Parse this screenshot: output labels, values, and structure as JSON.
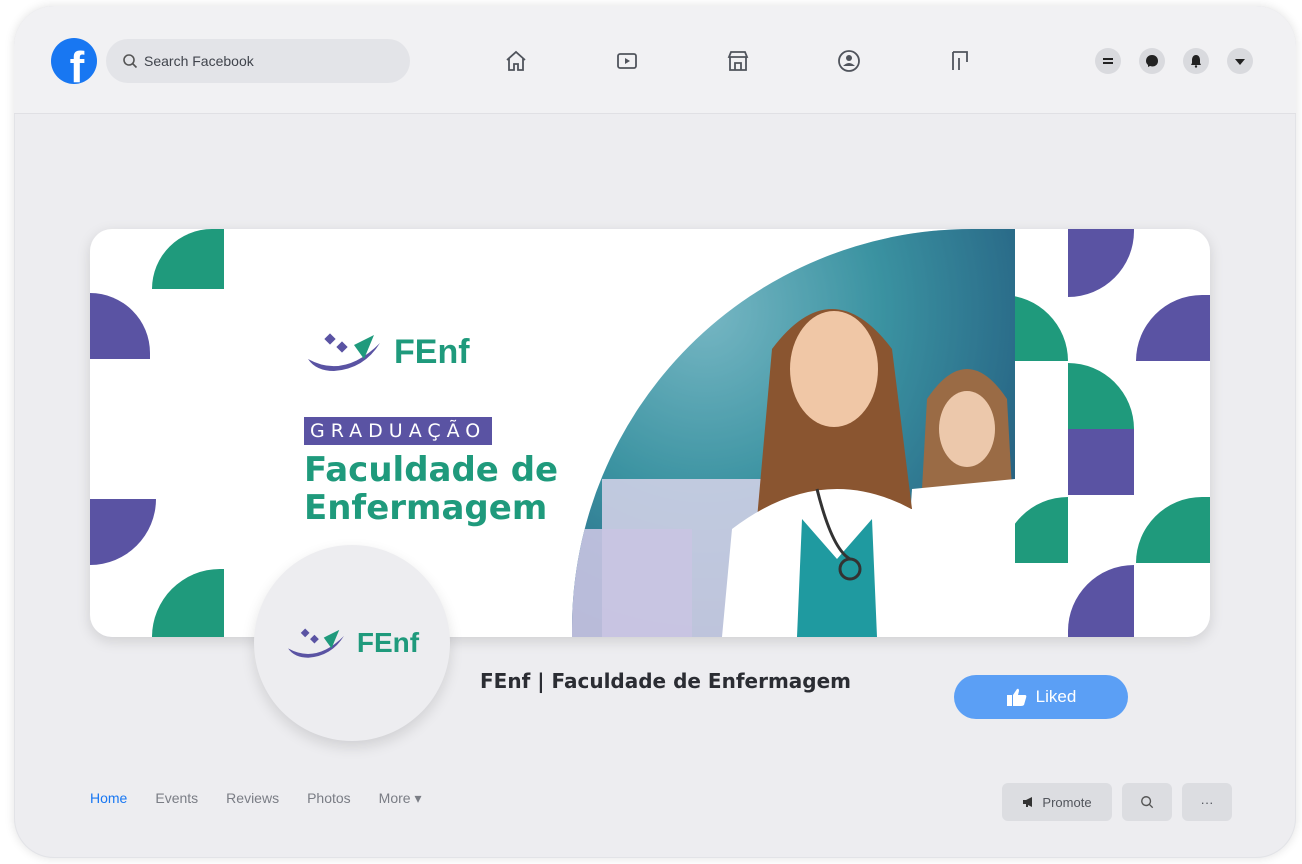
{
  "topbar": {
    "search_placeholder": "Search Facebook",
    "nav_icons": [
      "home-icon",
      "watch-icon",
      "marketplace-icon",
      "groups-icon",
      "gaming-icon"
    ],
    "right_icons": [
      "menu-icon",
      "messenger-icon",
      "notifications-icon",
      "account-dropdown-icon"
    ]
  },
  "cover": {
    "logo_text": "FEnf",
    "label": "GRADUAÇÃO",
    "headline_line1": "Faculdade de",
    "headline_line2": "Enfermagem"
  },
  "avatar": {
    "logo_text": "FEnf"
  },
  "page": {
    "name": "FEnf | Faculdade de Enfermagem",
    "liked_label": "Liked"
  },
  "tabs": [
    "Home",
    "Events",
    "Reviews",
    "Photos",
    "More ▾"
  ],
  "actions": {
    "promote_label": "Promote",
    "more_label": "···"
  },
  "colors": {
    "facebook_blue": "#1877f2",
    "brand_green": "#1f9a7c",
    "brand_purple": "#5a53a3",
    "liked_button": "#5b9ff5"
  }
}
